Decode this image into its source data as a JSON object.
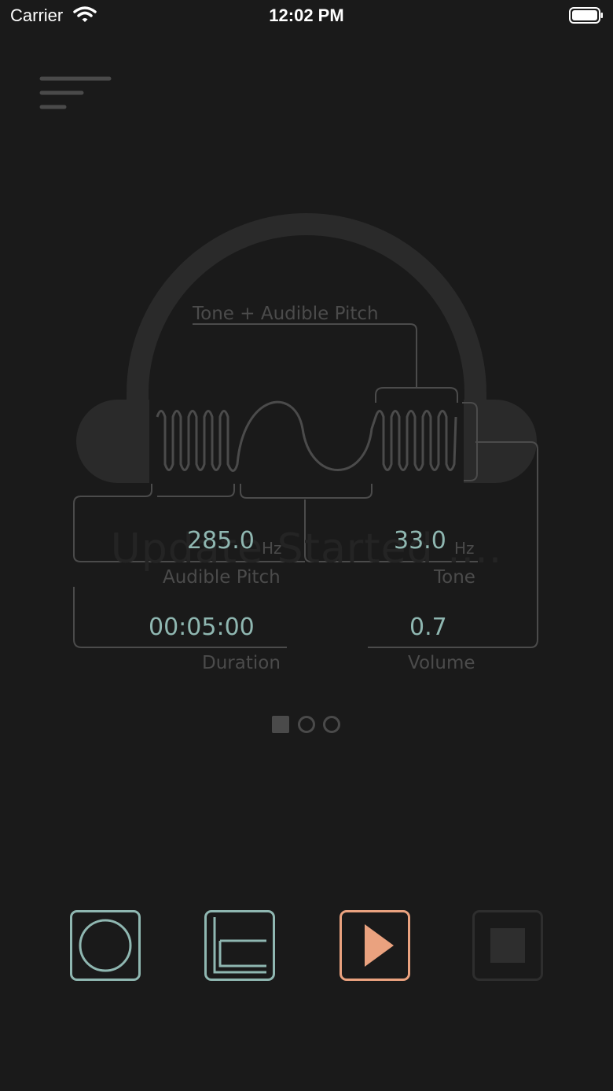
{
  "status_bar": {
    "carrier": "Carrier",
    "time": "12:02 PM"
  },
  "diagram": {
    "watermark_text": "Update Started ....",
    "tone_plus_pitch_label": "Tone + Audible Pitch"
  },
  "readouts": {
    "audible_pitch": {
      "value": "285.0",
      "unit": "Hz",
      "label": "Audible Pitch"
    },
    "tone": {
      "value": "33.0",
      "unit": "Hz",
      "label": "Tone"
    },
    "duration": {
      "value": "00:05:00",
      "label": "Duration"
    },
    "volume": {
      "value": "0.7",
      "label": "Volume"
    }
  },
  "pager": {
    "pages": 3,
    "current": 1
  },
  "controls": [
    "record",
    "chart",
    "play",
    "stop"
  ],
  "icons": {
    "menu": "menu-lines-icon",
    "record": "circle-icon",
    "chart": "chart-axis-icon",
    "play": "play-icon",
    "stop": "stop-icon"
  },
  "colors": {
    "background": "#1a1a1a",
    "accent_teal": "#8fb7b1",
    "accent_orange": "#eaa27f",
    "muted": "#4a4a4a"
  }
}
